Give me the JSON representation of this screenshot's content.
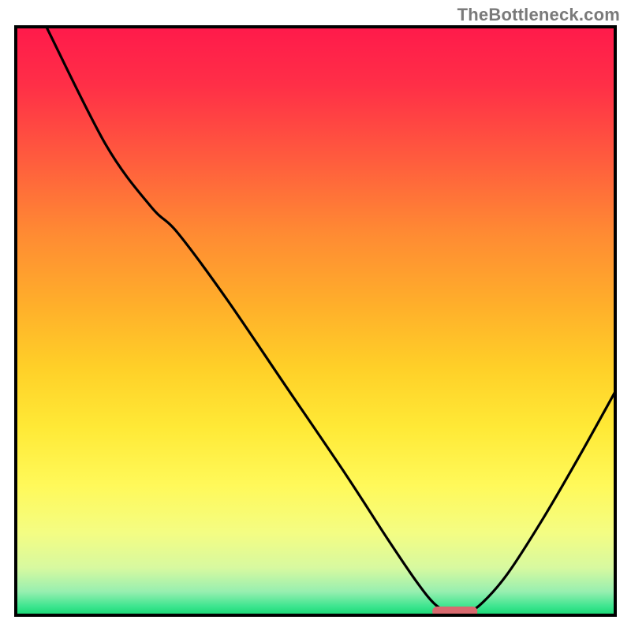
{
  "watermark": "TheBottleneck.com",
  "chart_data": {
    "type": "line",
    "title": "",
    "xlabel": "",
    "ylabel": "",
    "xlim": [
      0,
      100
    ],
    "ylim": [
      0,
      100
    ],
    "grid": false,
    "background_gradient": [
      {
        "stop": 0.0,
        "color": "#ff1a4b"
      },
      {
        "stop": 0.1,
        "color": "#ff2f47"
      },
      {
        "stop": 0.22,
        "color": "#ff5a3e"
      },
      {
        "stop": 0.35,
        "color": "#ff8a33"
      },
      {
        "stop": 0.48,
        "color": "#ffb12a"
      },
      {
        "stop": 0.58,
        "color": "#ffd028"
      },
      {
        "stop": 0.68,
        "color": "#ffe936"
      },
      {
        "stop": 0.78,
        "color": "#fff95a"
      },
      {
        "stop": 0.86,
        "color": "#f4fd83"
      },
      {
        "stop": 0.92,
        "color": "#d7f9a0"
      },
      {
        "stop": 0.96,
        "color": "#97efb0"
      },
      {
        "stop": 0.985,
        "color": "#3de58f"
      },
      {
        "stop": 1.0,
        "color": "#17d873"
      }
    ],
    "series": [
      {
        "name": "bottleneck-curve",
        "points": [
          {
            "x": 5.1,
            "y": 100.0
          },
          {
            "x": 15.0,
            "y": 80.0
          },
          {
            "x": 22.5,
            "y": 69.5
          },
          {
            "x": 27.0,
            "y": 65.0
          },
          {
            "x": 35.0,
            "y": 54.0
          },
          {
            "x": 45.0,
            "y": 39.0
          },
          {
            "x": 55.0,
            "y": 24.0
          },
          {
            "x": 62.0,
            "y": 13.0
          },
          {
            "x": 67.0,
            "y": 5.5
          },
          {
            "x": 70.0,
            "y": 1.8
          },
          {
            "x": 72.5,
            "y": 0.5
          },
          {
            "x": 75.0,
            "y": 0.5
          },
          {
            "x": 77.5,
            "y": 1.8
          },
          {
            "x": 82.0,
            "y": 7.0
          },
          {
            "x": 88.0,
            "y": 16.5
          },
          {
            "x": 94.0,
            "y": 27.0
          },
          {
            "x": 100.0,
            "y": 38.0
          }
        ]
      }
    ],
    "marker": {
      "name": "optimal-range",
      "x_start": 69.5,
      "x_end": 77.0,
      "y": 0.6,
      "color": "#d86a6f"
    },
    "frame": {
      "stroke": "#000000",
      "stroke_width": 4
    }
  }
}
